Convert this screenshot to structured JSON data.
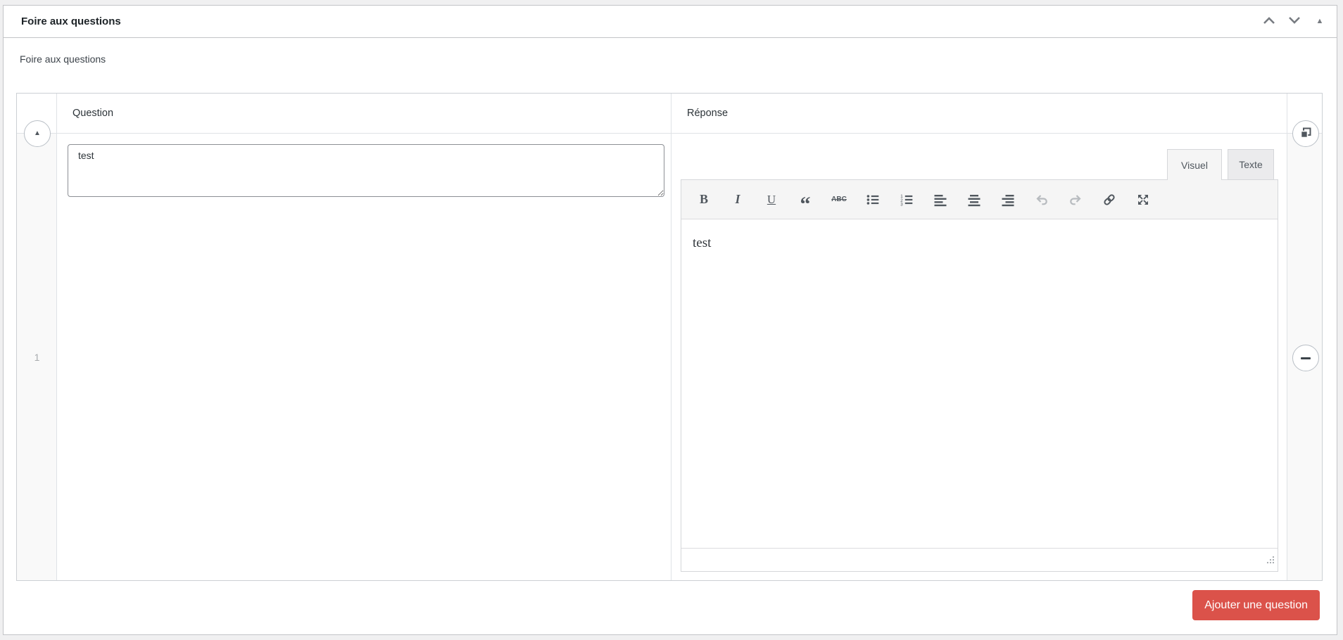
{
  "metabox": {
    "title": "Foire aux questions"
  },
  "repeater": {
    "label": "Foire aux questions",
    "columns": {
      "question": "Question",
      "answer": "Réponse"
    },
    "rows": [
      {
        "number": "1",
        "question": "test",
        "answer": "test"
      }
    ],
    "add_button": "Ajouter une question"
  },
  "editor": {
    "tabs": {
      "visual": "Visuel",
      "text": "Texte"
    },
    "toolbar_buttons": [
      "bold",
      "italic",
      "underline",
      "blockquote",
      "strikethrough",
      "bulleted-list",
      "numbered-list",
      "align-left",
      "align-center",
      "align-right",
      "undo",
      "redo",
      "link",
      "fullscreen"
    ],
    "glyphs": {
      "bold": "B",
      "italic": "I",
      "underline": "U",
      "blockquote": "“",
      "strikethrough": "ABC"
    }
  },
  "icons": {
    "metabox_toggle": "▲",
    "row_collapse": "▲"
  },
  "colors": {
    "add_button_bg": "#db524a",
    "toolbar_icon": "#50575e",
    "toolbar_icon_disabled": "#b7bbbf",
    "postbox_border": "#c3c4c7",
    "table_border": "#ccd0d4",
    "input_border": "#8c8f94",
    "header_icon": "#787c82",
    "handle_col_bg": "#f9f9f9"
  }
}
